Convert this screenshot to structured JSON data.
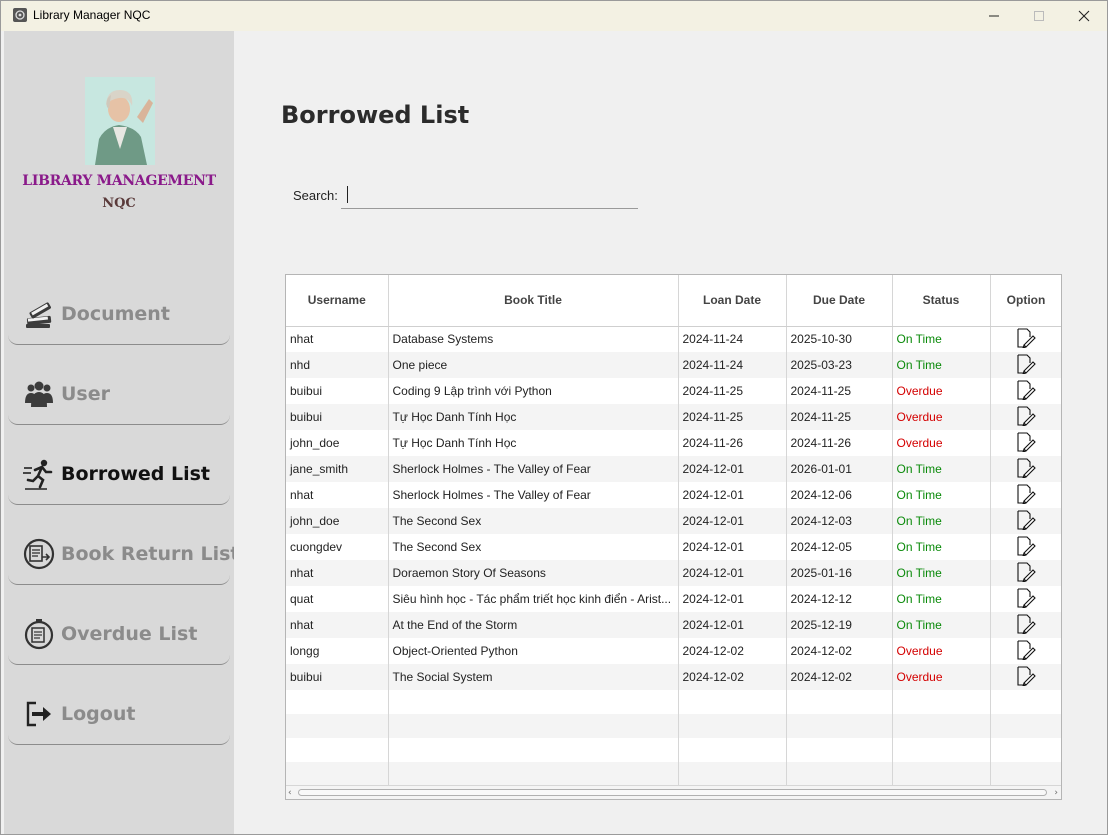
{
  "window": {
    "title": "Library Manager NQC"
  },
  "brand": {
    "line1": "LIBRARY MANAGEMENT",
    "line2": "NQC"
  },
  "nav": [
    {
      "label": "Document",
      "icon": "books-icon",
      "active": false
    },
    {
      "label": "User",
      "icon": "users-icon",
      "active": false
    },
    {
      "label": "Borrowed List",
      "icon": "running-icon",
      "active": true
    },
    {
      "label": "Book Return List",
      "icon": "return-list-icon",
      "active": false
    },
    {
      "label": "Overdue List",
      "icon": "overdue-clock-icon",
      "active": false
    },
    {
      "label": "Logout",
      "icon": "logout-icon",
      "active": false
    }
  ],
  "page": {
    "title": "Borrowed List"
  },
  "search": {
    "label": "Search:",
    "value": "",
    "placeholder": ""
  },
  "table": {
    "columns": [
      "Username",
      "Book Title",
      "Loan Date",
      "Due Date",
      "Status",
      "Option"
    ],
    "rows": [
      [
        "nhat",
        "Database Systems",
        "2024-11-24",
        "2025-10-30",
        "On Time"
      ],
      [
        "nhd",
        "One piece",
        "2024-11-24",
        "2025-03-23",
        "On Time"
      ],
      [
        "buibui",
        "Coding 9 Lập trình với Python",
        "2024-11-25",
        "2024-11-25",
        "Overdue"
      ],
      [
        "buibui",
        "Tự Học Danh Tính Học",
        "2024-11-25",
        "2024-11-25",
        "Overdue"
      ],
      [
        "john_doe",
        "Tự Học Danh Tính Học",
        "2024-11-26",
        "2024-11-26",
        "Overdue"
      ],
      [
        "jane_smith",
        "Sherlock Holmes - The Valley of Fear",
        "2024-12-01",
        "2026-01-01",
        "On Time"
      ],
      [
        "nhat",
        "Sherlock Holmes - The Valley of Fear",
        "2024-12-01",
        "2024-12-06",
        "On Time"
      ],
      [
        "john_doe",
        "The Second Sex",
        "2024-12-01",
        "2024-12-03",
        "On Time"
      ],
      [
        "cuongdev",
        "The Second Sex",
        "2024-12-01",
        "2024-12-05",
        "On Time"
      ],
      [
        "nhat",
        "Doraemon Story Of Seasons",
        "2024-12-01",
        "2025-01-16",
        "On Time"
      ],
      [
        "quat",
        "Siêu hình học - Tác phẩm triết học kinh điển - Arist...",
        "2024-12-01",
        "2024-12-12",
        "On Time"
      ],
      [
        "nhat",
        "At the End of the Storm",
        "2024-12-01",
        "2025-12-19",
        "On Time"
      ],
      [
        "longg",
        "Object-Oriented Python",
        "2024-12-02",
        "2024-12-02",
        "Overdue"
      ],
      [
        "buibui",
        "The Social System",
        "2024-12-02",
        "2024-12-02",
        "Overdue"
      ]
    ],
    "option_icon": "edit-document-icon"
  },
  "colors": {
    "on_time": "#0a8a0a",
    "overdue": "#d40000",
    "brand_purple": "#8a1a8a",
    "sidebar_bg": "#d9d9d9"
  }
}
